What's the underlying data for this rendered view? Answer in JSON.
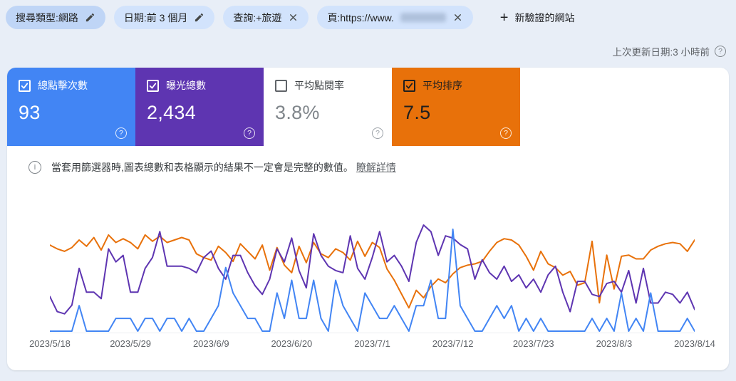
{
  "filters": {
    "chips": [
      {
        "label": "搜尋類型:網路",
        "action": "edit"
      },
      {
        "label": "日期:前 3 個月",
        "action": "edit"
      },
      {
        "label": "查詢:+旅遊",
        "action": "remove"
      },
      {
        "label": "頁:https://www.",
        "action": "remove",
        "value_redacted": true
      }
    ],
    "add_site_label": "新驗證的網站",
    "add_glyph": "+"
  },
  "status": {
    "last_updated": "上次更新日期:3 小時前"
  },
  "icons": {
    "help_glyph": "?",
    "info_glyph": "i"
  },
  "metrics": [
    {
      "label": "總點擊次數",
      "value": "93",
      "checked": true,
      "color": "#4285f4",
      "text_color": "#ffffff"
    },
    {
      "label": "曝光總數",
      "value": "2,434",
      "checked": true,
      "color": "#5e35b1",
      "text_color": "#ffffff"
    },
    {
      "label": "平均點閱率",
      "value": "3.8%",
      "checked": false,
      "color": "#ffffff",
      "text_color": "#80868b"
    },
    {
      "label": "平均排序",
      "value": "7.5",
      "checked": true,
      "color": "#e8710a",
      "text_color": "#1f1f1f"
    }
  ],
  "notice": {
    "text": "當套用篩選器時,圖表總數和表格顯示的結果不一定會是完整的數值。",
    "link": "瞭解詳情"
  },
  "chart_data": {
    "type": "line",
    "title": "",
    "xlabel": "",
    "ylabel": "",
    "grid": false,
    "legend_position": "none",
    "x_tick_labels": [
      "2023/5/18",
      "2023/5/29",
      "2023/6/9",
      "2023/6/20",
      "2023/7/1",
      "2023/7/12",
      "2023/7/23",
      "2023/8/3",
      "2023/8/14"
    ],
    "date_start": "2023/5/18",
    "date_end": "2023/8/14",
    "points_per_series": 89,
    "note": "daily values estimated from pixels; no y-axis labels shown in UI",
    "series": [
      {
        "key": "clicks",
        "name": "總點擊次數",
        "color": "#4285f4",
        "total_shown": 93,
        "scale_max": 8.5,
        "values": [
          0,
          0,
          0,
          0,
          2,
          0,
          0,
          0,
          0,
          1,
          1,
          1,
          0,
          1,
          1,
          0,
          1,
          1,
          0,
          1,
          0,
          0,
          1,
          2,
          5,
          3,
          2,
          1,
          1,
          0,
          0,
          3,
          1,
          4,
          1,
          1,
          4,
          1,
          0,
          4,
          2,
          1,
          0,
          3,
          2,
          1,
          1,
          2,
          1,
          0,
          2,
          2,
          4,
          1,
          1,
          8,
          2,
          1,
          0,
          0,
          1,
          2,
          1,
          2,
          0,
          1,
          0,
          1,
          0,
          0,
          0,
          0,
          0,
          0,
          1,
          0,
          1,
          0,
          3,
          0,
          1,
          0,
          3,
          0,
          0,
          0,
          0,
          1,
          0
        ]
      },
      {
        "key": "impressions",
        "name": "曝光總數",
        "color": "#5e35b1",
        "total_shown": 2434,
        "scale_max": 50,
        "values": [
          16,
          9,
          8,
          12,
          29,
          18,
          18,
          15,
          38,
          32,
          35,
          18,
          18,
          29,
          34,
          46,
          30,
          30,
          30,
          29,
          27,
          34,
          37,
          29,
          24,
          35,
          35,
          27,
          21,
          17,
          24,
          38,
          32,
          43,
          28,
          20,
          45,
          35,
          30,
          28,
          27,
          44,
          29,
          24,
          34,
          46,
          32,
          35,
          30,
          23,
          41,
          49,
          46,
          35,
          44,
          43,
          40,
          38,
          24,
          33,
          27,
          24,
          30,
          23,
          26,
          20,
          24,
          18,
          26,
          30,
          18,
          9,
          23,
          23,
          17,
          16,
          22,
          23,
          18,
          28,
          13,
          29,
          13,
          13,
          18,
          17,
          13,
          18,
          10
        ]
      },
      {
        "key": "position",
        "name": "平均排序",
        "color": "#e8710a",
        "average_shown": 7.5,
        "inverted": true,
        "axis_min": 4.5,
        "axis_max": 13,
        "values": [
          6.6,
          6.9,
          7.1,
          6.8,
          6.2,
          6.7,
          6.0,
          7.0,
          5.8,
          6.4,
          6.1,
          6.4,
          6.9,
          5.8,
          6.3,
          5.9,
          6.4,
          6.2,
          6.0,
          6.2,
          7.3,
          7.6,
          7.8,
          6.7,
          7.2,
          7.9,
          6.5,
          7.1,
          7.7,
          6.6,
          8.6,
          6.8,
          8.2,
          8.8,
          6.7,
          8.0,
          6.4,
          7.3,
          7.6,
          6.9,
          7.2,
          7.8,
          6.3,
          7.5,
          6.4,
          6.8,
          8.5,
          9.4,
          10.5,
          11.6,
          10.2,
          10.8,
          9.9,
          9.3,
          9.6,
          8.9,
          8.4,
          8.2,
          8.1,
          7.9,
          7.1,
          6.4,
          6.1,
          6.2,
          6.6,
          7.5,
          8.6,
          7.1,
          8.1,
          8.4,
          9.0,
          8.7,
          9.8,
          9.6,
          6.3,
          11.2,
          7.4,
          10.1,
          7.5,
          7.4,
          7.7,
          7.7,
          7.0,
          6.7,
          6.5,
          6.4,
          6.5,
          7.1,
          6.2
        ]
      }
    ]
  }
}
